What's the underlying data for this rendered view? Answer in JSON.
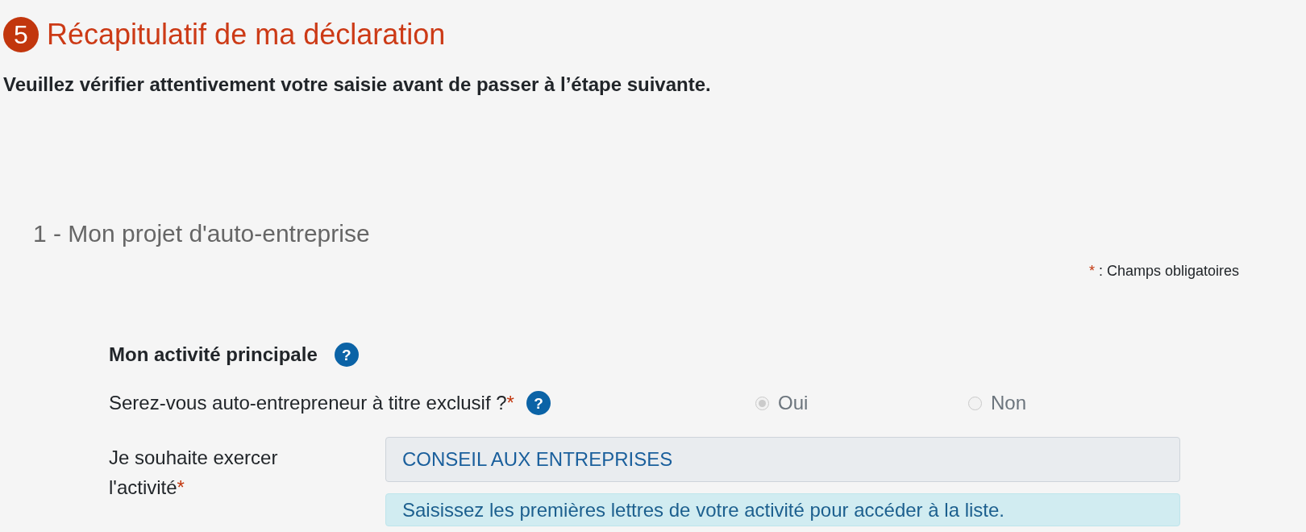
{
  "step": {
    "number": "5",
    "title": "Récapitulatif de ma déclaration"
  },
  "instruction": "Veuillez vérifier attentivement votre saisie avant de passer à l’étape suivante.",
  "section": {
    "title": "1 - Mon projet d'auto-entreprise",
    "required_note": {
      "mark": "*",
      "text": ": Champs obligatoires"
    },
    "group": {
      "title": "Mon activité principale",
      "help": "?"
    },
    "fields": [
      {
        "kind": "radio",
        "label": "Serez-vous auto-entrepreneur à titre exclusif ?",
        "required_mark": "*",
        "help": "?",
        "options": [
          {
            "label": "Oui",
            "selected": true,
            "disabled": true
          },
          {
            "label": "Non",
            "selected": false,
            "disabled": true
          }
        ]
      },
      {
        "kind": "text",
        "label": "Je souhaite exercer l'activité",
        "required_mark": "*",
        "value": "CONSEIL AUX ENTREPRISES",
        "disabled": true,
        "hint": "Saisissez les premières lettres de votre activité pour accéder à la liste."
      }
    ]
  }
}
